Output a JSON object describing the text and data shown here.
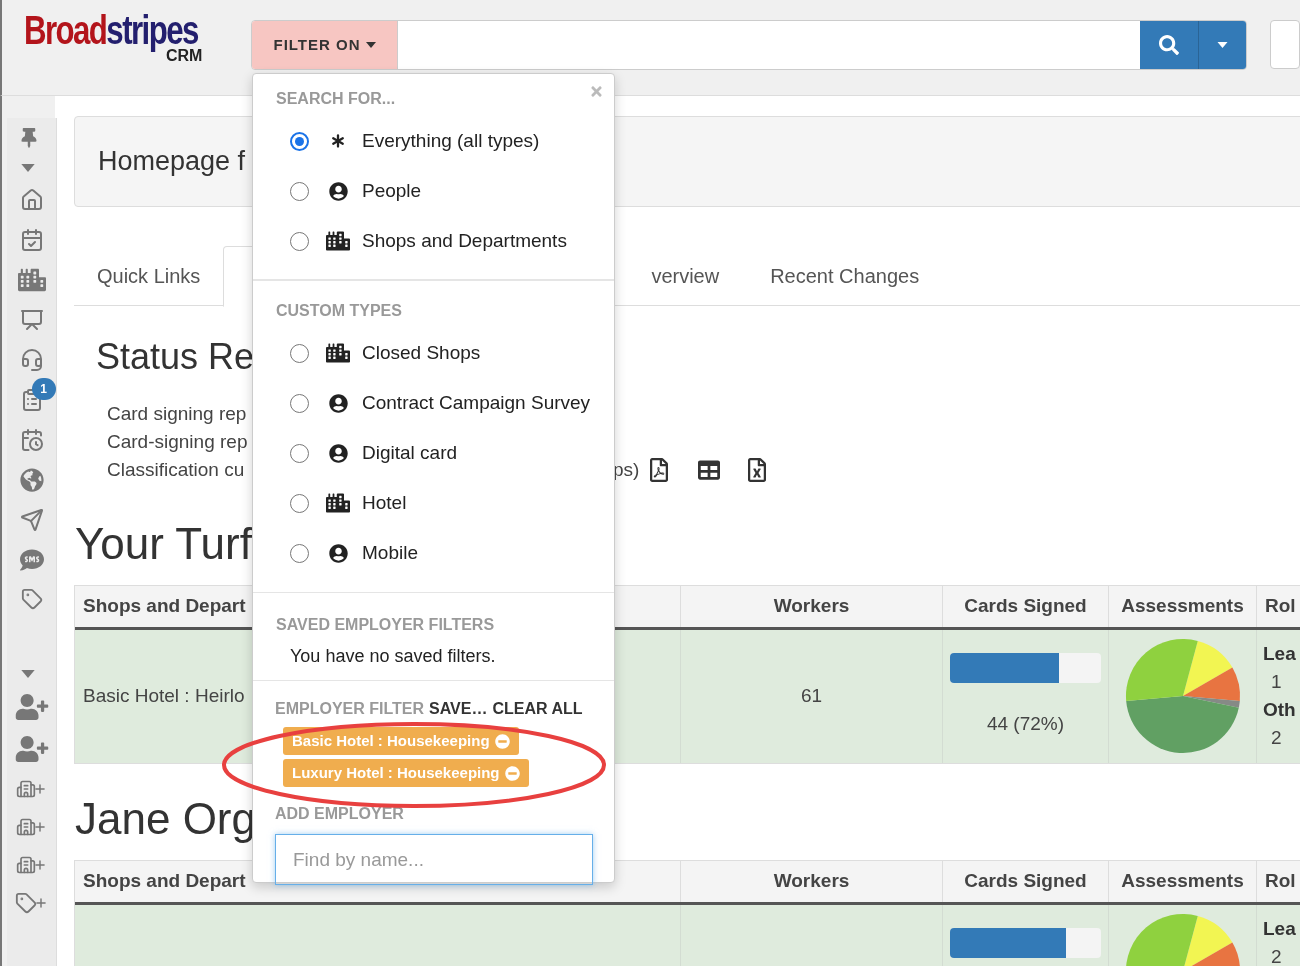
{
  "logo": {
    "parts": [
      "Broad",
      "stripes"
    ],
    "sub": "CRM"
  },
  "search_bar": {
    "filter_button": "FILTER ON"
  },
  "sidebar": {
    "badge": "1"
  },
  "page_title": "Homepage f",
  "tabs": [
    {
      "label": "Quick Links",
      "selected": false
    },
    {
      "selected": true
    },
    {
      "label": "verview",
      "selected": false
    },
    {
      "label": "Recent Changes",
      "selected": false
    }
  ],
  "status": {
    "title": "Status Re",
    "lines": [
      "Card signing rep",
      "Card-signing rep",
      "Classification cu"
    ],
    "tail": "ps)"
  },
  "sections": [
    {
      "title": "Your Turf",
      "columns": [
        "Shops and Depart",
        "Workers",
        "Cards Signed",
        "Assessments",
        "Rol"
      ],
      "rows": [
        {
          "name": "Basic Hotel : Heirlo",
          "workers": "61",
          "cards": {
            "level": 0.72,
            "reading": "44 (72%)"
          },
          "roles": [
            {
              "kind": "label",
              "text": "Lea"
            },
            {
              "kind": "value",
              "text": "1"
            },
            {
              "kind": "label",
              "text": "Oth"
            },
            {
              "kind": "value",
              "text": "2"
            }
          ]
        }
      ]
    },
    {
      "title": "Jane Org",
      "columns": [
        "Shops and Depart",
        "Workers",
        "Cards Signed",
        "Assessments",
        "Rol"
      ],
      "rows": [
        {
          "cards": {
            "level": 0.77
          },
          "roles": [
            {
              "kind": "label",
              "text": "Lea"
            },
            {
              "kind": "value",
              "text": "2"
            }
          ]
        }
      ]
    }
  ],
  "filter_menu": {
    "groups": [
      {
        "title": "SEARCH FOR...",
        "options": [
          {
            "label": "Everything (all types)",
            "kind": "all",
            "selected": true
          },
          {
            "label": "People",
            "kind": "person",
            "selected": false
          },
          {
            "label": "Shops and Departments",
            "kind": "building",
            "selected": false
          }
        ]
      },
      {
        "title": "CUSTOM TYPES",
        "options": [
          {
            "label": "Closed Shops",
            "kind": "building",
            "selected": false
          },
          {
            "label": "Contract Campaign Survey",
            "kind": "person",
            "selected": false
          },
          {
            "label": "Digital card",
            "kind": "person",
            "selected": false
          },
          {
            "label": "Hotel",
            "kind": "building",
            "selected": false
          },
          {
            "label": "Mobile",
            "kind": "person",
            "selected": false
          }
        ]
      }
    ],
    "saved": {
      "title": "SAVED EMPLOYER FILTERS",
      "text": "You have no saved filters."
    },
    "employer_filter": {
      "title": "EMPLOYER FILTER",
      "actions": [
        "SAVE…",
        "CLEAR ALL"
      ],
      "tags": [
        "Basic Hotel : Housekeeping",
        "Luxury Hotel : Housekeeping"
      ]
    },
    "add_employer": {
      "title": "ADD EMPLOYER",
      "placeholder": "Find by name..."
    }
  }
}
